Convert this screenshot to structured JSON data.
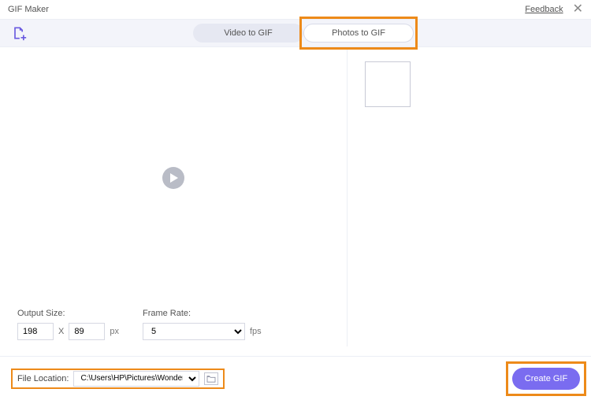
{
  "window": {
    "title": "GIF Maker",
    "feedback": "Feedback"
  },
  "tabs": {
    "video": "Video to GIF",
    "photos": "Photos to GIF"
  },
  "output": {
    "size_label": "Output Size:",
    "width": "198",
    "height": "89",
    "unit": "px",
    "frame_rate_label": "Frame Rate:",
    "fps_value": "5",
    "fps_unit": "fps"
  },
  "file": {
    "label": "File Location:",
    "path": "C:\\Users\\HP\\Pictures\\Wondersh"
  },
  "actions": {
    "create": "Create GIF"
  }
}
